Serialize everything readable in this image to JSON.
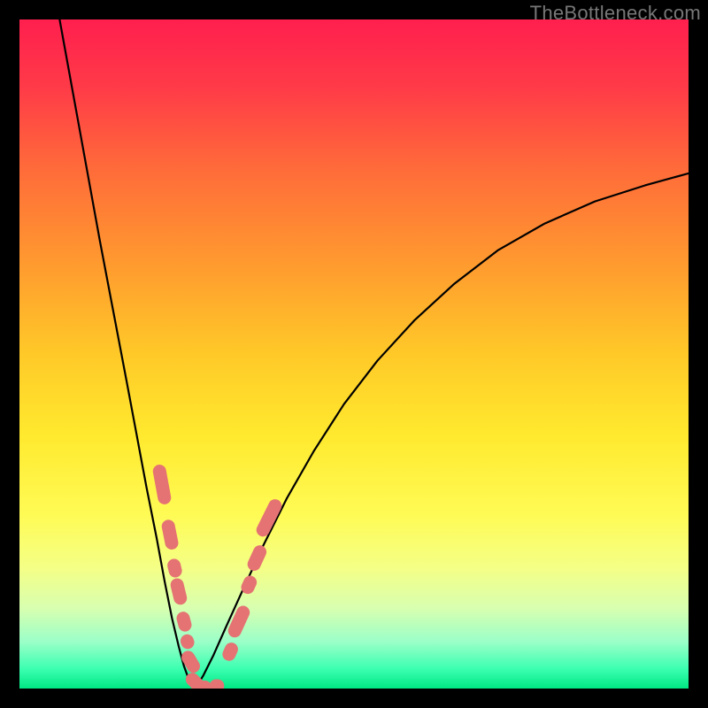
{
  "watermark": "TheBottleneck.com",
  "colors": {
    "black": "#000000",
    "curve": "#000000",
    "marker_fill": "#e57373",
    "marker_stroke": "#c94e4e",
    "gradient_stops": [
      {
        "offset": 0.0,
        "color": "#ff1f4e"
      },
      {
        "offset": 0.1,
        "color": "#ff3a48"
      },
      {
        "offset": 0.22,
        "color": "#ff6a3a"
      },
      {
        "offset": 0.35,
        "color": "#ff9530"
      },
      {
        "offset": 0.5,
        "color": "#ffc928"
      },
      {
        "offset": 0.62,
        "color": "#ffe92e"
      },
      {
        "offset": 0.74,
        "color": "#fffb55"
      },
      {
        "offset": 0.82,
        "color": "#f4ff86"
      },
      {
        "offset": 0.88,
        "color": "#d8ffb0"
      },
      {
        "offset": 0.93,
        "color": "#9bffc8"
      },
      {
        "offset": 0.97,
        "color": "#3dffb1"
      },
      {
        "offset": 1.0,
        "color": "#00e884"
      }
    ]
  },
  "chart_data": {
    "type": "line",
    "title": "",
    "xlabel": "",
    "ylabel": "",
    "xlim": [
      0,
      1
    ],
    "ylim": [
      0,
      1
    ],
    "series": [
      {
        "name": "left-branch",
        "x": [
          0.06,
          0.08,
          0.1,
          0.12,
          0.14,
          0.16,
          0.175,
          0.19,
          0.205,
          0.217,
          0.228,
          0.238,
          0.246,
          0.253,
          0.259,
          0.263
        ],
        "y": [
          1.0,
          0.89,
          0.78,
          0.67,
          0.565,
          0.46,
          0.38,
          0.3,
          0.225,
          0.16,
          0.105,
          0.063,
          0.033,
          0.014,
          0.004,
          0.0
        ]
      },
      {
        "name": "right-branch",
        "x": [
          0.263,
          0.275,
          0.29,
          0.31,
          0.335,
          0.365,
          0.4,
          0.44,
          0.485,
          0.535,
          0.59,
          0.65,
          0.715,
          0.785,
          0.86,
          0.935,
          1.0
        ],
        "y": [
          0.0,
          0.02,
          0.05,
          0.095,
          0.15,
          0.215,
          0.285,
          0.355,
          0.425,
          0.49,
          0.55,
          0.605,
          0.655,
          0.695,
          0.728,
          0.752,
          0.77
        ]
      }
    ],
    "markers": [
      {
        "branch": "left",
        "x": 0.213,
        "y": 0.305,
        "len": 0.06
      },
      {
        "branch": "left",
        "x": 0.225,
        "y": 0.23,
        "len": 0.045
      },
      {
        "branch": "left",
        "x": 0.232,
        "y": 0.18,
        "len": 0.028
      },
      {
        "branch": "left",
        "x": 0.238,
        "y": 0.145,
        "len": 0.04
      },
      {
        "branch": "left",
        "x": 0.246,
        "y": 0.1,
        "len": 0.03
      },
      {
        "branch": "left",
        "x": 0.251,
        "y": 0.07,
        "len": 0.022
      },
      {
        "branch": "left",
        "x": 0.256,
        "y": 0.04,
        "len": 0.035
      },
      {
        "branch": "left",
        "x": 0.262,
        "y": 0.01,
        "len": 0.03
      },
      {
        "branch": "flat",
        "x": 0.272,
        "y": 0.002,
        "len": 0.03
      },
      {
        "branch": "flat",
        "x": 0.295,
        "y": 0.004,
        "len": 0.022
      },
      {
        "branch": "right",
        "x": 0.315,
        "y": 0.055,
        "len": 0.028
      },
      {
        "branch": "right",
        "x": 0.328,
        "y": 0.1,
        "len": 0.05
      },
      {
        "branch": "right",
        "x": 0.343,
        "y": 0.155,
        "len": 0.028
      },
      {
        "branch": "right",
        "x": 0.355,
        "y": 0.195,
        "len": 0.04
      },
      {
        "branch": "right",
        "x": 0.373,
        "y": 0.255,
        "len": 0.06
      }
    ]
  }
}
